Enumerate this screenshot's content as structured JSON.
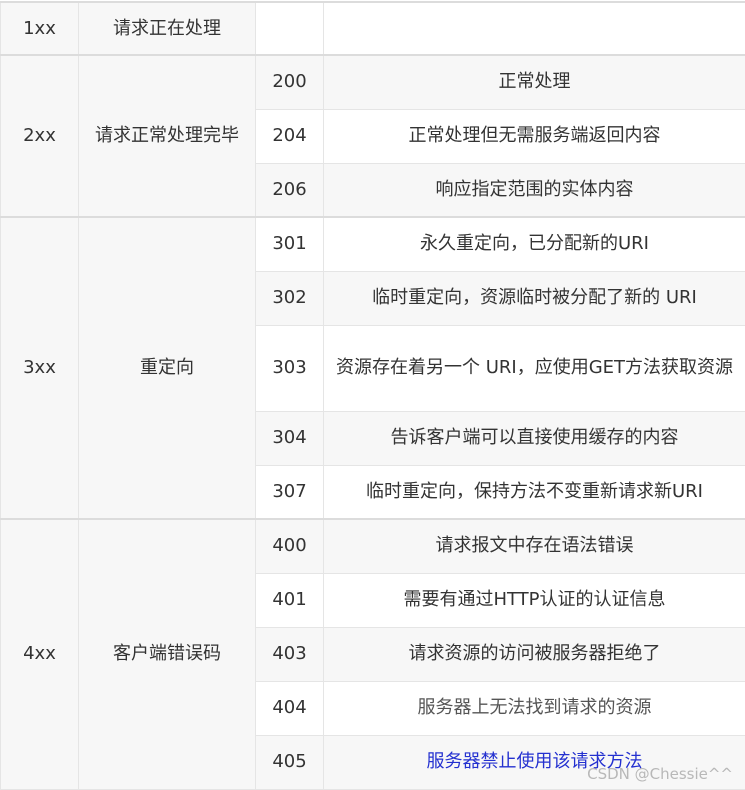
{
  "groups": [
    {
      "class": "1xx",
      "meaning": "请求正在处理",
      "rows": [
        {
          "code": "",
          "desc": ""
        }
      ]
    },
    {
      "class": "2xx",
      "meaning": "请求正常处理完毕",
      "rows": [
        {
          "code": "200",
          "desc": "正常处理"
        },
        {
          "code": "204",
          "desc": "正常处理但无需服务端返回内容"
        },
        {
          "code": "206",
          "desc": "响应指定范围的实体内容"
        }
      ]
    },
    {
      "class": "3xx",
      "meaning": "重定向",
      "rows": [
        {
          "code": "301",
          "desc": "永久重定向，已分配新的URI"
        },
        {
          "code": "302",
          "desc": "临时重定向，资源临时被分配了新的 URI"
        },
        {
          "code": "303",
          "desc": "资源存在着另一个 URI，应使用GET方法获取资源"
        },
        {
          "code": "304",
          "desc": "告诉客户端可以直接使用缓存的内容"
        },
        {
          "code": "307",
          "desc": "临时重定向，保持方法不变重新请求新URI"
        }
      ]
    },
    {
      "class": "4xx",
      "meaning": "客户端错误码",
      "rows": [
        {
          "code": "400",
          "desc": "请求报文中存在语法错误"
        },
        {
          "code": "401",
          "desc": "需要有通过HTTP认证的认证信息"
        },
        {
          "code": "403",
          "desc": "请求资源的访问被服务器拒绝了"
        },
        {
          "code": "404",
          "desc": "服务器上无法找到请求的资源"
        },
        {
          "code": "405",
          "desc": "服务器禁止使用该请求方法"
        }
      ]
    }
  ],
  "watermark": "CSDN @Chessie^^",
  "colors": {
    "link_text": "#2431d0",
    "alt_row_bg": "#f7f7f7",
    "border": "#e5e5e5"
  }
}
